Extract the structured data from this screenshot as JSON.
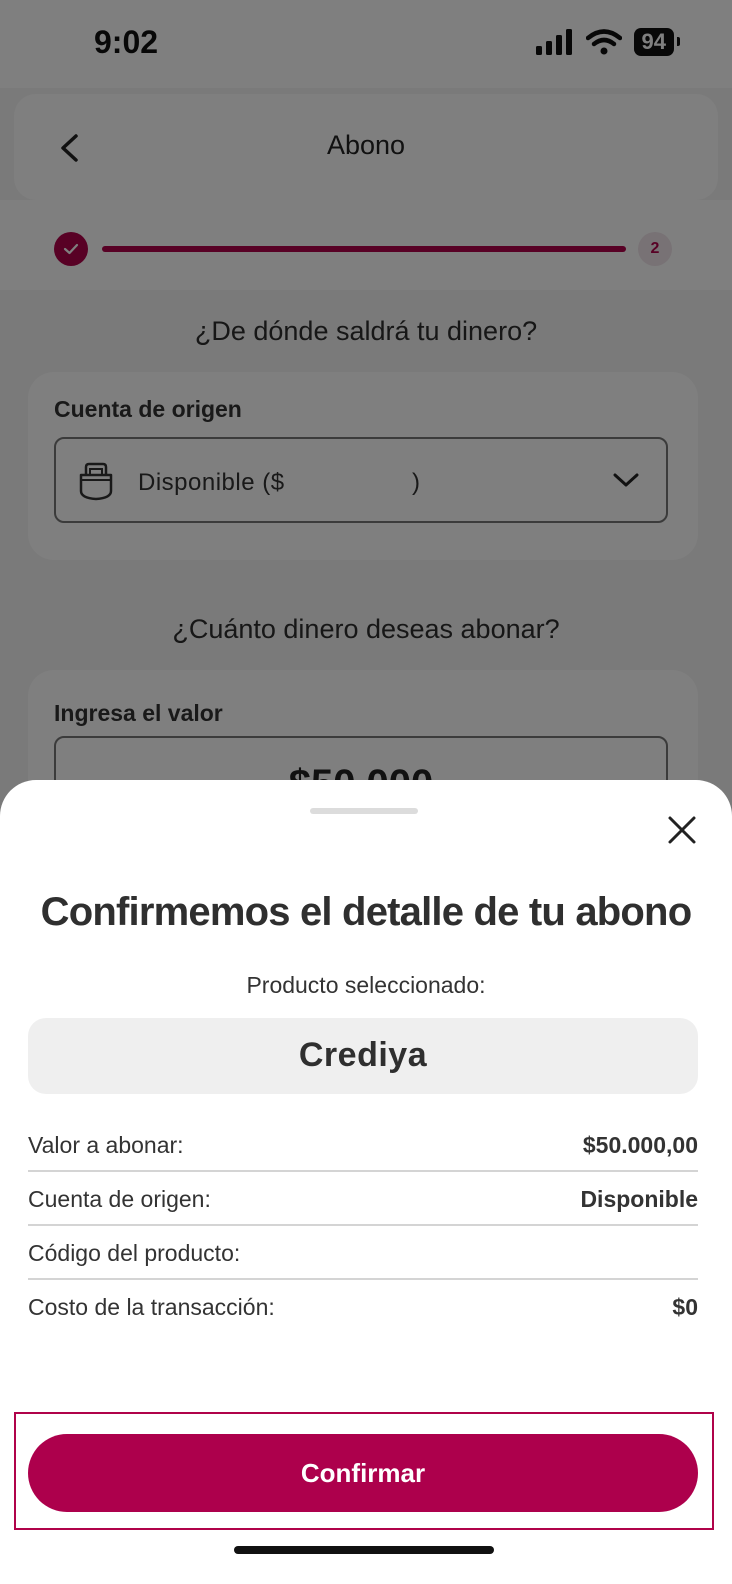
{
  "status_bar": {
    "time": "9:02",
    "battery": "94"
  },
  "header": {
    "title": "Abono"
  },
  "progress": {
    "current_step": "2"
  },
  "origin_section": {
    "question": "¿De dónde saldrá tu dinero?",
    "label": "Cuenta de origen",
    "selected_prefix": "Disponible ($",
    "selected_suffix": ")"
  },
  "amount_section": {
    "question": "¿Cuánto dinero deseas abonar?",
    "label": "Ingresa el valor",
    "value": "$50.000"
  },
  "sheet": {
    "title": "Confirmemos el detalle de tu abono",
    "product_label": "Producto seleccionado:",
    "product_name": "Crediya",
    "details": [
      {
        "label": "Valor a abonar:",
        "value": "$50.000,00"
      },
      {
        "label": "Cuenta de origen:",
        "value": "Disponible"
      },
      {
        "label": "Código del producto:",
        "value": ""
      },
      {
        "label": "Costo de la transacción:",
        "value": "$0"
      }
    ],
    "confirm_label": "Confirmar"
  },
  "colors": {
    "brand": "#ad004c",
    "overlay": "rgba(0,0,0,0.5)"
  },
  "icons": [
    "back-chevron-icon",
    "check-icon",
    "wallet-icon",
    "chevron-down-icon",
    "close-icon",
    "signal-icon",
    "wifi-icon"
  ]
}
